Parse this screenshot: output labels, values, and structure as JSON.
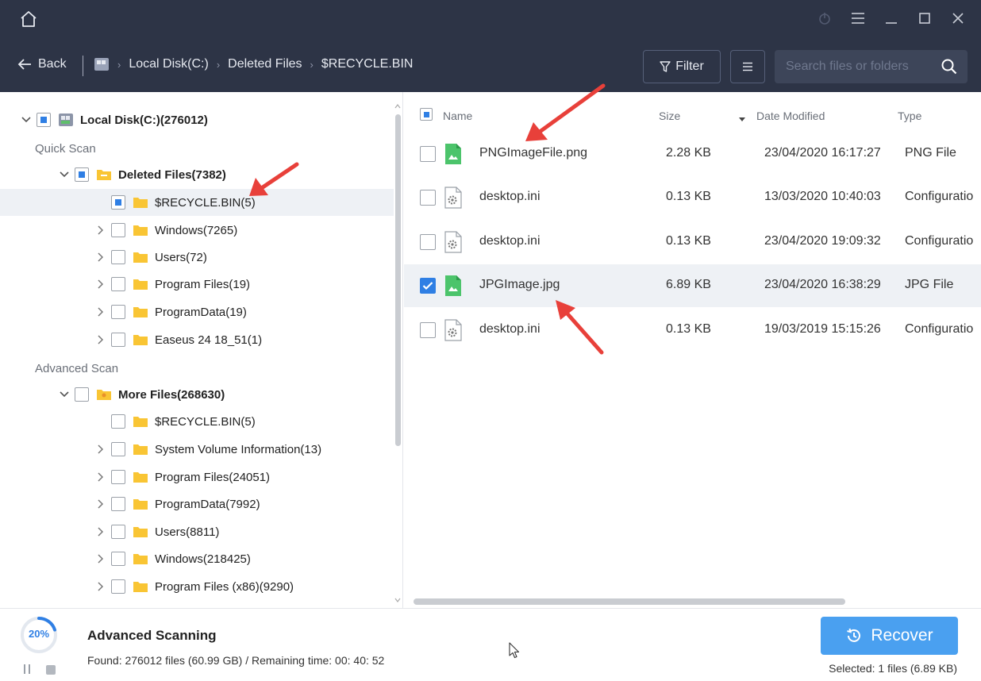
{
  "nav": {
    "back_label": "Back",
    "breadcrumb": [
      "Local Disk(C:)",
      "Deleted Files",
      "$RECYCLE.BIN"
    ],
    "filter_label": "Filter",
    "search_placeholder": "Search files or folders"
  },
  "tree": {
    "root_label": "Local Disk(C:)(276012)",
    "quick_scan_label": "Quick Scan",
    "deleted_files_label": "Deleted Files(7382)",
    "deleted_children": [
      "$RECYCLE.BIN(5)",
      "Windows(7265)",
      "Users(72)",
      "Program Files(19)",
      "ProgramData(19)",
      "Easeus 24 18_51(1)"
    ],
    "advanced_scan_label": "Advanced Scan",
    "more_files_label": "More Files(268630)",
    "more_children": [
      "$RECYCLE.BIN(5)",
      "System Volume Information(13)",
      "Program Files(24051)",
      "ProgramData(7992)",
      "Users(8811)",
      "Windows(218425)",
      "Program Files (x86)(9290)"
    ]
  },
  "list": {
    "columns": {
      "name": "Name",
      "size": "Size",
      "date": "Date Modified",
      "type": "Type"
    },
    "rows": [
      {
        "name": "PNGImageFile.png",
        "size": "2.28 KB",
        "date": "23/04/2020 16:17:27",
        "type": "PNG File",
        "icon": "image-file-icon",
        "checked": false
      },
      {
        "name": "desktop.ini",
        "size": "0.13 KB",
        "date": "13/03/2020 10:40:03",
        "type": "Configuratio",
        "icon": "config-file-icon",
        "checked": false
      },
      {
        "name": "desktop.ini",
        "size": "0.13 KB",
        "date": "23/04/2020 19:09:32",
        "type": "Configuratio",
        "icon": "config-file-icon",
        "checked": false
      },
      {
        "name": "JPGImage.jpg",
        "size": "6.89 KB",
        "date": "23/04/2020 16:38:29",
        "type": "JPG File",
        "icon": "image-file-icon",
        "checked": true
      },
      {
        "name": "desktop.ini",
        "size": "0.13 KB",
        "date": "19/03/2019 15:15:26",
        "type": "Configuratio",
        "icon": "config-file-icon",
        "checked": false
      }
    ]
  },
  "status": {
    "progress_label": "20%",
    "progress_value": 0.2,
    "title": "Advanced Scanning",
    "found_text": "Found: 276012 files (60.99 GB) / Remaining time: 00: 40: 52",
    "recover_label": "Recover",
    "selected_text": "Selected: 1 files (6.89 KB)"
  },
  "colors": {
    "titlebar_bg": "#2d3446",
    "accent": "#2f7fe4",
    "recover_bg": "#4aa0f0",
    "folder": "#f9c534",
    "image_icon": "#4cc46b",
    "annotation_arrow": "#e8403a"
  }
}
